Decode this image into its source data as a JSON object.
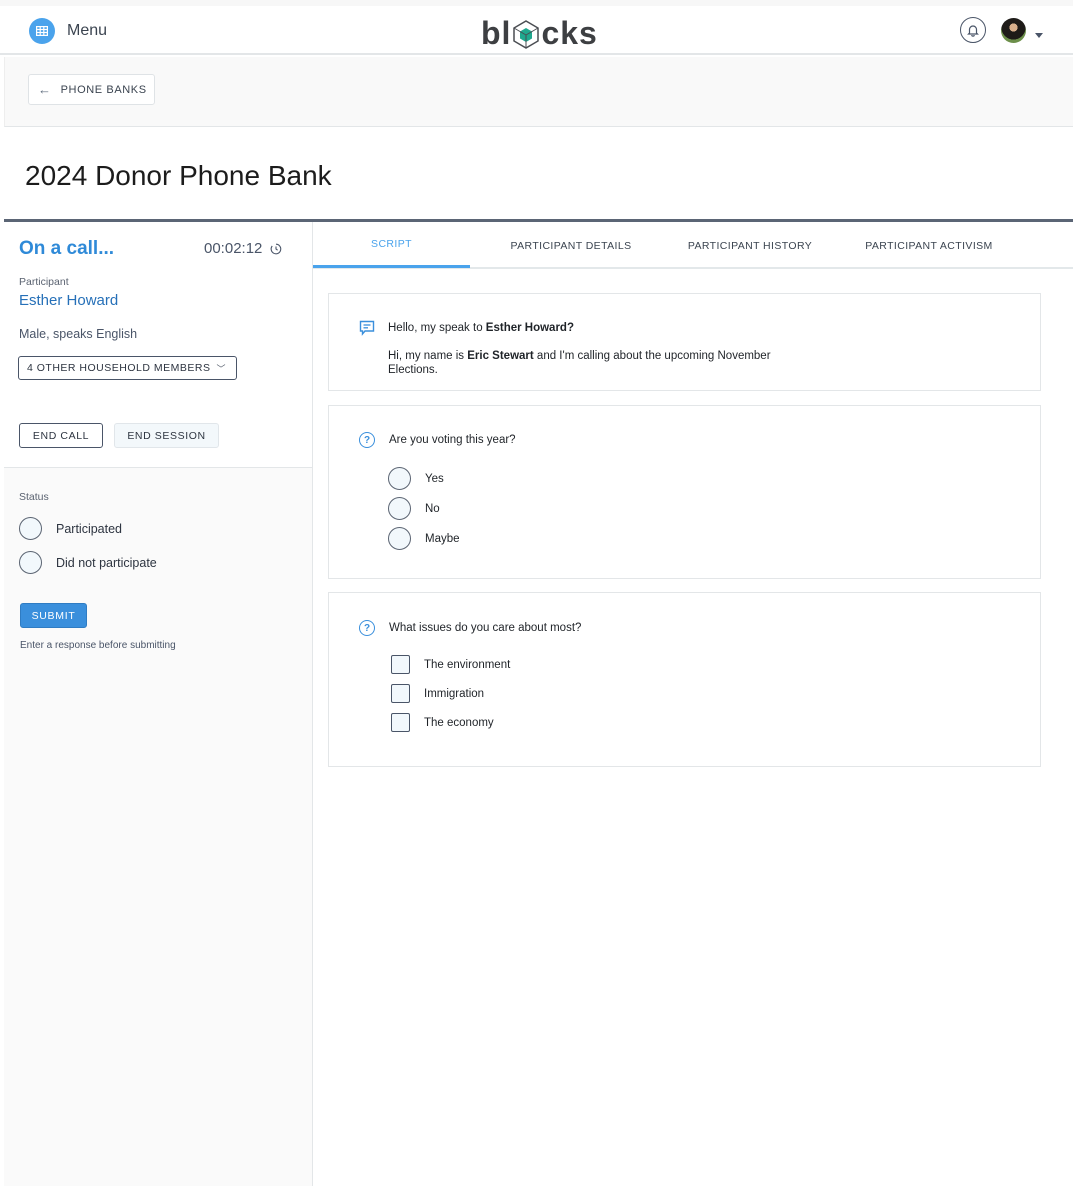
{
  "header": {
    "menu_label": "Menu",
    "menu_icon": "grid-icon",
    "logo_text_left": "bl",
    "logo_text_right": "cks",
    "logo_icon": "cube-icon",
    "notification_icon": "bell-icon",
    "avatar_icon": "user-avatar",
    "accent_color": "#4aa3ec",
    "logo_cube_color": "#1fa88e"
  },
  "subnav": {
    "back_label": "PHONE BANKS",
    "back_icon": "arrow-left-icon"
  },
  "page": {
    "title": "2024 Donor Phone Bank"
  },
  "call": {
    "status": "On a call...",
    "timer": "00:02:12",
    "timer_icon": "timer-icon",
    "participant_label": "Participant",
    "participant_name": "Esther Howard",
    "participant_desc": "Male, speaks English",
    "household_label": "4 OTHER HOUSEHOLD MEMBERS",
    "end_call_label": "END CALL",
    "end_session_label": "END SESSION"
  },
  "status_form": {
    "label": "Status",
    "options": [
      "Participated",
      "Did not participate"
    ],
    "submit_label": "SUBMIT",
    "hint": "Enter a response before submitting",
    "submit_color": "#3a8fdc"
  },
  "tabs": [
    {
      "label": "SCRIPT",
      "active": true
    },
    {
      "label": "PARTICIPANT DETAILS",
      "active": false
    },
    {
      "label": "PARTICIPANT HISTORY",
      "active": false
    },
    {
      "label": "PARTICIPANT ACTIVISM",
      "active": false
    }
  ],
  "script": {
    "intro": {
      "icon": "message-icon",
      "line1_prefix": "Hello, my speak to ",
      "line1_bold": "Esther Howard?",
      "line2_prefix": "Hi, my name is ",
      "line2_bold": "Eric Stewart",
      "line2_suffix": " and I'm calling about the upcoming November Elections."
    },
    "questions": [
      {
        "icon": "question-icon",
        "text": "Are you voting this year?",
        "type": "radio",
        "options": [
          "Yes",
          "No",
          "Maybe"
        ]
      },
      {
        "icon": "question-icon",
        "text": "What issues do you care about most?",
        "type": "checkbox",
        "options": [
          "The environment",
          "Immigration",
          "The economy"
        ]
      }
    ]
  }
}
